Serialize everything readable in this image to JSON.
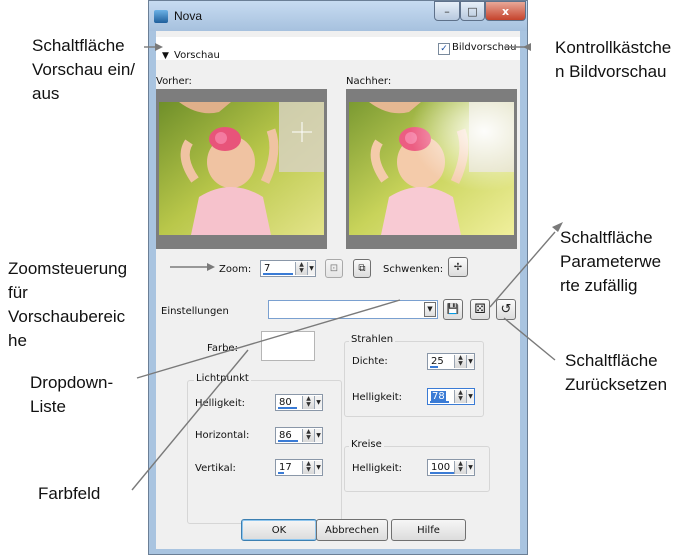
{
  "window": {
    "title": "Nova",
    "minimize_glyph": "–",
    "maximize_glyph": "□",
    "close_glyph": "x"
  },
  "preview_bar": {
    "toggle_arrow": "▼",
    "toggle_label": "Vorschau",
    "checkbox_checked": true,
    "checkbox_mark": "✓",
    "checkbox_label": "Bildvorschau"
  },
  "preview": {
    "before_label": "Vorher:",
    "after_label": "Nachher:"
  },
  "zoom_row": {
    "zoom_label": "Zoom:",
    "zoom_value": "7",
    "pan_label": "Schwenken:",
    "pan_glyph": "✢",
    "fit_glyph": "⊡",
    "actual_glyph": "⧉"
  },
  "settings": {
    "label": "Einstellungen",
    "value": "",
    "save_glyph": "💾",
    "randomize_glyph": "⚄",
    "reset_glyph": "↺"
  },
  "color": {
    "label": "Farbe:",
    "value": "#ffffff"
  },
  "lichtpunkt": {
    "title": "Lichtpunkt",
    "helligkeit_label": "Helligkeit:",
    "helligkeit_value": "80",
    "horizontal_label": "Horizontal:",
    "horizontal_value": "86",
    "vertikal_label": "Vertikal:",
    "vertikal_value": "17"
  },
  "strahlen": {
    "title": "Strahlen",
    "dichte_label": "Dichte:",
    "dichte_value": "25",
    "helligkeit_label": "Helligkeit:",
    "helligkeit_value": "78"
  },
  "kreise": {
    "title": "Kreise",
    "helligkeit_label": "Helligkeit:",
    "helligkeit_value": "100"
  },
  "buttons": {
    "ok": "OK",
    "cancel": "Abbrechen",
    "help": "Hilfe"
  },
  "callouts": {
    "preview_toggle": [
      "Schaltfläche",
      "Vorschau ein/",
      "aus"
    ],
    "image_preview_checkbox": [
      "Kontrollkästche",
      "n Bildvorschau"
    ],
    "randomize": [
      "Schaltfläche",
      "Parameterwe",
      "rte zufällig"
    ],
    "zoom_control": [
      "Zoomsteuerung",
      "für",
      "Vorschaubereic",
      "he"
    ],
    "reset": [
      "Schaltfläche",
      "Zurücksetzen"
    ],
    "dropdown": [
      "Dropdown-",
      "Liste"
    ],
    "color_field": [
      "Farbfeld"
    ]
  }
}
